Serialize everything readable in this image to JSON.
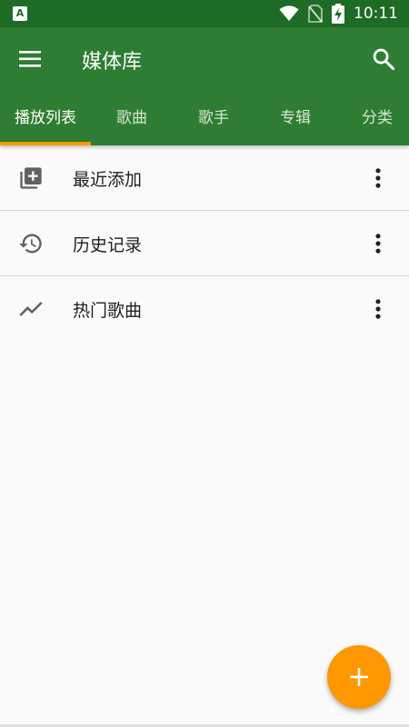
{
  "status_bar": {
    "time": "10:11",
    "icons": [
      "app-a-icon",
      "wifi-icon",
      "no-sim-icon",
      "battery-charging-icon"
    ],
    "app_badge": "A"
  },
  "app_bar": {
    "title": "媒体库",
    "menu_icon": "menu-icon",
    "search_icon": "search-icon",
    "color": "#2e7d32"
  },
  "tabs": [
    {
      "label": "播放列表",
      "active": true
    },
    {
      "label": "歌曲",
      "active": false
    },
    {
      "label": "歌手",
      "active": false
    },
    {
      "label": "专辑",
      "active": false
    },
    {
      "label": "分类",
      "active": false
    }
  ],
  "playlists": [
    {
      "label": "最近添加",
      "icon": "playlist-add-icon"
    },
    {
      "label": "历史记录",
      "icon": "history-icon"
    },
    {
      "label": "热门歌曲",
      "icon": "trending-icon"
    }
  ],
  "fab": {
    "icon": "plus-icon",
    "color": "#ff9800"
  },
  "colors": {
    "accent": "#ff9800",
    "primary": "#2e7d32",
    "primary_dark": "#1e6b26"
  }
}
